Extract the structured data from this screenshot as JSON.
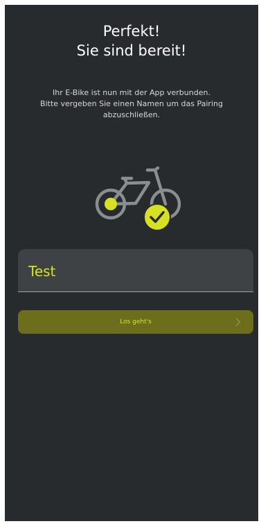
{
  "header": {
    "title_line1": "Perfekt!",
    "title_line2": "Sie sind bereit!"
  },
  "intro": {
    "line1": "Ihr E-Bike ist nun mit der App verbunden.",
    "line2": "Bitte vergeben Sie einen Namen um das Pairing",
    "line3": "abzuschließen."
  },
  "illustration": {
    "icon": "bike-connected-check-icon"
  },
  "name_field": {
    "value": "Test"
  },
  "primary_button": {
    "label": "Los geht's",
    "icon": "chevron-right-icon"
  },
  "colors": {
    "background": "#282b2e",
    "accent": "#d6e21f",
    "button_bg": "#6d6e1c",
    "field_bg": "#3e4245",
    "bike_gray": "#8a8e91"
  }
}
